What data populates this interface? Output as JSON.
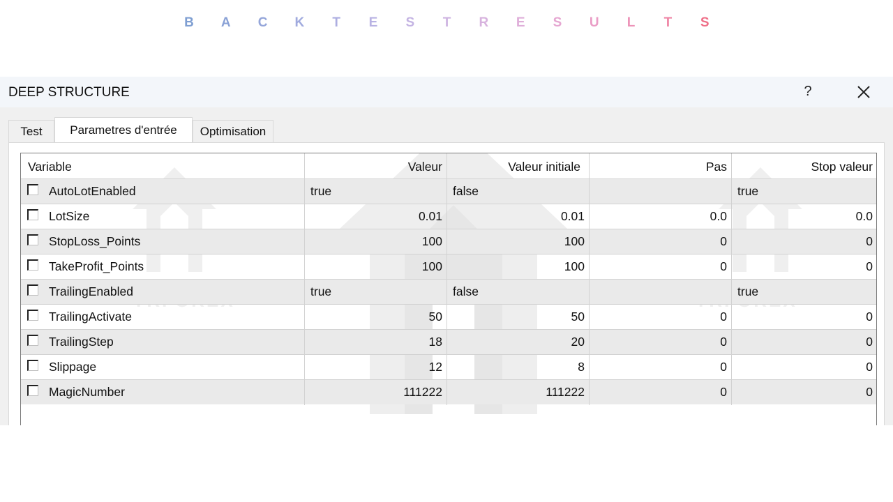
{
  "banner": {
    "letters": [
      {
        "ch": "B",
        "color": "#7f9fd2"
      },
      {
        "ch": "A",
        "color": "#8aa2d6"
      },
      {
        "ch": "C",
        "color": "#95a6da"
      },
      {
        "ch": "K",
        "color": "#a0aade"
      },
      {
        "ch": "T",
        "color": "#adaee1"
      },
      {
        "ch": "E",
        "color": "#b8b2e3"
      },
      {
        "ch": "S",
        "color": "#c4b4e3"
      },
      {
        "ch": "T",
        "color": "#ceb4e1"
      },
      {
        "ch": "R",
        "color": "#d7b2de"
      },
      {
        "ch": "E",
        "color": "#dfaed9"
      },
      {
        "ch": "S",
        "color": "#e5a6d1"
      },
      {
        "ch": "U",
        "color": "#ea9dc6"
      },
      {
        "ch": "L",
        "color": "#ed93b8"
      },
      {
        "ch": "T",
        "color": "#ef86a6"
      },
      {
        "ch": "S",
        "color": "#ef6f88"
      }
    ]
  },
  "dialog": {
    "title": "DEEP STRUCTURE",
    "help_label": "?",
    "close_icon": "close-icon",
    "tabs": [
      {
        "label": "Test",
        "active": false
      },
      {
        "label": "Parametres d'entrée",
        "active": true
      },
      {
        "label": "Optimisation",
        "active": false
      }
    ]
  },
  "grid": {
    "headers": [
      "Variable",
      "Valeur",
      "Valeur initiale",
      "Pas",
      "Stop valeur"
    ],
    "rows": [
      {
        "name": "AutoLotEnabled",
        "valeur": "true",
        "initiale": "false",
        "pas": "",
        "stop": "true",
        "bool": true
      },
      {
        "name": "LotSize",
        "valeur": "0.01",
        "initiale": "0.01",
        "pas": "0.0",
        "stop": "0.0",
        "bool": false
      },
      {
        "name": "StopLoss_Points",
        "valeur": "100",
        "initiale": "100",
        "pas": "0",
        "stop": "0",
        "bool": false
      },
      {
        "name": "TakeProfit_Points",
        "valeur": "100",
        "initiale": "100",
        "pas": "0",
        "stop": "0",
        "bool": false
      },
      {
        "name": "TrailingEnabled",
        "valeur": "true",
        "initiale": "false",
        "pas": "",
        "stop": "true",
        "bool": true
      },
      {
        "name": "TrailingActivate",
        "valeur": "50",
        "initiale": "50",
        "pas": "0",
        "stop": "0",
        "bool": false
      },
      {
        "name": "TrailingStep",
        "valeur": "18",
        "initiale": "20",
        "pas": "0",
        "stop": "0",
        "bool": false
      },
      {
        "name": "Slippage",
        "valeur": "12",
        "initiale": "8",
        "pas": "0",
        "stop": "0",
        "bool": false
      },
      {
        "name": "MagicNumber",
        "valeur": "111222",
        "initiale": "111222",
        "pas": "0",
        "stop": "0",
        "bool": false
      }
    ]
  },
  "watermark": {
    "text": "YRFOREX",
    "color": "#d8d8d8"
  }
}
